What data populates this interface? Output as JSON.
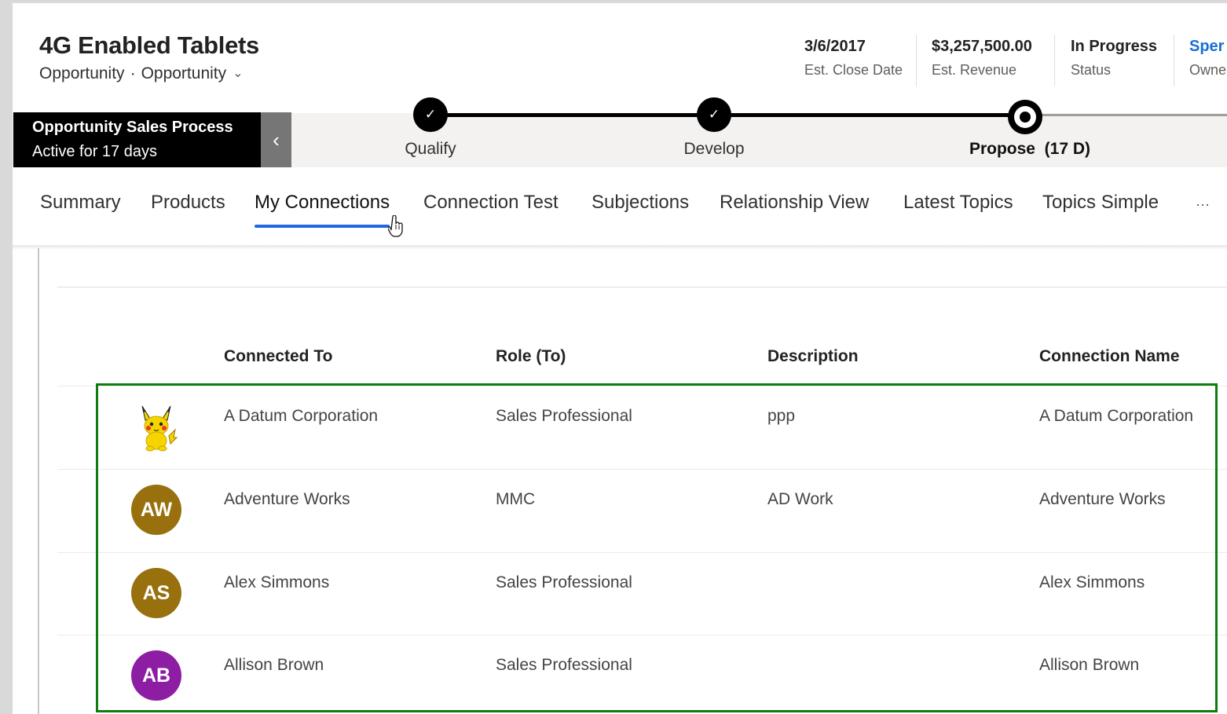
{
  "record": {
    "title": "4G Enabled Tablets",
    "entity": "Opportunity",
    "form": "Opportunity"
  },
  "header_fields": [
    {
      "value": "3/6/2017",
      "label": "Est. Close Date"
    },
    {
      "value": "$3,257,500.00",
      "label": "Est. Revenue"
    },
    {
      "value": "In Progress",
      "label": "Status"
    },
    {
      "value": "Sper",
      "label": "Owne"
    }
  ],
  "process": {
    "name": "Opportunity Sales Process",
    "active": "Active for 17 days",
    "stages": [
      {
        "label": "Qualify",
        "state": "done"
      },
      {
        "label": "Develop",
        "state": "done"
      },
      {
        "label": "Propose",
        "duration": "(17 D)",
        "state": "active"
      }
    ]
  },
  "tabs": [
    "Summary",
    "Products",
    "My Connections",
    "Connection Test",
    "Subjections",
    "Relationship View",
    "Latest Topics",
    "Topics Simple",
    "···"
  ],
  "selected_tab": "My Connections",
  "grid": {
    "columns": [
      "Connected To",
      "Role (To)",
      "Description",
      "Connection Name"
    ],
    "rows": [
      {
        "avatar_type": "image",
        "avatar_icon": "pikachu-icon",
        "connected_to": "A Datum Corporation",
        "role": "Sales Professional",
        "description": "ppp",
        "connection_name": "A Datum Corporation"
      },
      {
        "avatar_type": "initials",
        "initials": "AW",
        "avatar_color": "#98700d",
        "connected_to": "Adventure Works",
        "role": "MMC",
        "description": "AD Work",
        "connection_name": "Adventure Works"
      },
      {
        "avatar_type": "initials",
        "initials": "AS",
        "avatar_color": "#98700d",
        "connected_to": "Alex Simmons",
        "role": "Sales Professional",
        "description": "",
        "connection_name": "Alex Simmons"
      },
      {
        "avatar_type": "initials",
        "initials": "AB",
        "avatar_color": "#8d1da3",
        "connected_to": "Allison Brown",
        "role": "Sales Professional",
        "description": "",
        "connection_name": "Allison Brown"
      }
    ]
  },
  "colors": {
    "accent": "#2266e3",
    "highlight_border": "#107c10",
    "process_bar": "#000000"
  }
}
